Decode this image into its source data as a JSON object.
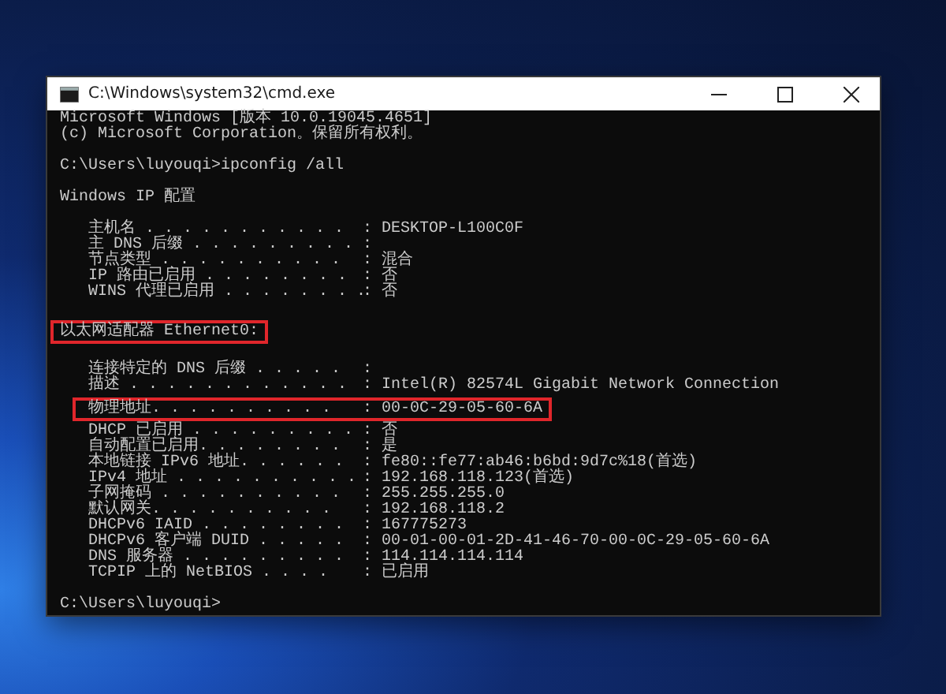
{
  "window": {
    "title": "C:\\Windows\\system32\\cmd.exe"
  },
  "console": {
    "lines": [
      {
        "kind": "text",
        "text": "Microsoft Windows [版本 10.0.19045.4651]",
        "highlighted": false
      },
      {
        "kind": "text",
        "text": "(c) Microsoft Corporation。保留所有权利。",
        "highlighted": false
      },
      {
        "kind": "blank"
      },
      {
        "kind": "text",
        "text": "C:\\Users\\luyouqi>ipconfig /all",
        "highlighted": false
      },
      {
        "kind": "blank"
      },
      {
        "kind": "text",
        "text": "Windows IP 配置",
        "highlighted": false
      },
      {
        "kind": "blank"
      },
      {
        "kind": "field",
        "label": "主机名 . . . . . . . . . . .",
        "value": ": DESKTOP-L100C0F",
        "highlighted": false
      },
      {
        "kind": "field",
        "label": "主 DNS 后缀 . . . . . . . . .",
        "value": ":",
        "highlighted": false
      },
      {
        "kind": "field",
        "label": "节点类型 . . . . . . . . . .",
        "value": ": 混合",
        "highlighted": false
      },
      {
        "kind": "field",
        "label": "IP 路由已启用 . . . . . . . .",
        "value": ": 否",
        "highlighted": false
      },
      {
        "kind": "field",
        "label": "WINS 代理已启用 . . . . . . . .",
        "value": ": 否",
        "highlighted": false
      },
      {
        "kind": "blank"
      },
      {
        "kind": "text",
        "text": "以太网适配器 Ethernet0:",
        "highlighted": true
      },
      {
        "kind": "blank"
      },
      {
        "kind": "field",
        "label": "连接特定的 DNS 后缀 . . . . .",
        "value": ":",
        "highlighted": false
      },
      {
        "kind": "field",
        "label": "描述 . . . . . . . . . . . .",
        "value": ": Intel(R) 82574L Gigabit Network Connection",
        "highlighted": false
      },
      {
        "kind": "field",
        "label": "物理地址. . . . . . . . . .",
        "value": ": 00-0C-29-05-60-6A",
        "highlighted": true
      },
      {
        "kind": "field",
        "label": "DHCP 已启用 . . . . . . . . .",
        "value": ": 否",
        "highlighted": false
      },
      {
        "kind": "field",
        "label": "自动配置已启用. . . . . . . .",
        "value": ": 是",
        "highlighted": false
      },
      {
        "kind": "field",
        "label": "本地链接 IPv6 地址. . . . . .",
        "value": ": fe80::fe77:ab46:b6bd:9d7c%18(首选)",
        "highlighted": false
      },
      {
        "kind": "field",
        "label": "IPv4 地址 . . . . . . . . . .",
        "value": ": 192.168.118.123(首选)",
        "highlighted": false
      },
      {
        "kind": "field",
        "label": "子网掩码 . . . . . . . . . .",
        "value": ": 255.255.255.0",
        "highlighted": false
      },
      {
        "kind": "field",
        "label": "默认网关. . . . . . . . . .",
        "value": ": 192.168.118.2",
        "highlighted": false
      },
      {
        "kind": "field",
        "label": "DHCPv6 IAID . . . . . . . .",
        "value": ": 167775273",
        "highlighted": false
      },
      {
        "kind": "field",
        "label": "DHCPv6 客户端 DUID . . . . .",
        "value": ": 00-01-00-01-2D-41-46-70-00-0C-29-05-60-6A",
        "highlighted": false
      },
      {
        "kind": "field",
        "label": "DNS 服务器 . . . . . . . . .",
        "value": ": 114.114.114.114",
        "highlighted": false
      },
      {
        "kind": "field",
        "label": "TCPIP 上的 NetBIOS . . . .",
        "value": ": 已启用",
        "highlighted": false
      },
      {
        "kind": "blank"
      },
      {
        "kind": "text",
        "text": "C:\\Users\\luyouqi>",
        "highlighted": false
      }
    ]
  }
}
